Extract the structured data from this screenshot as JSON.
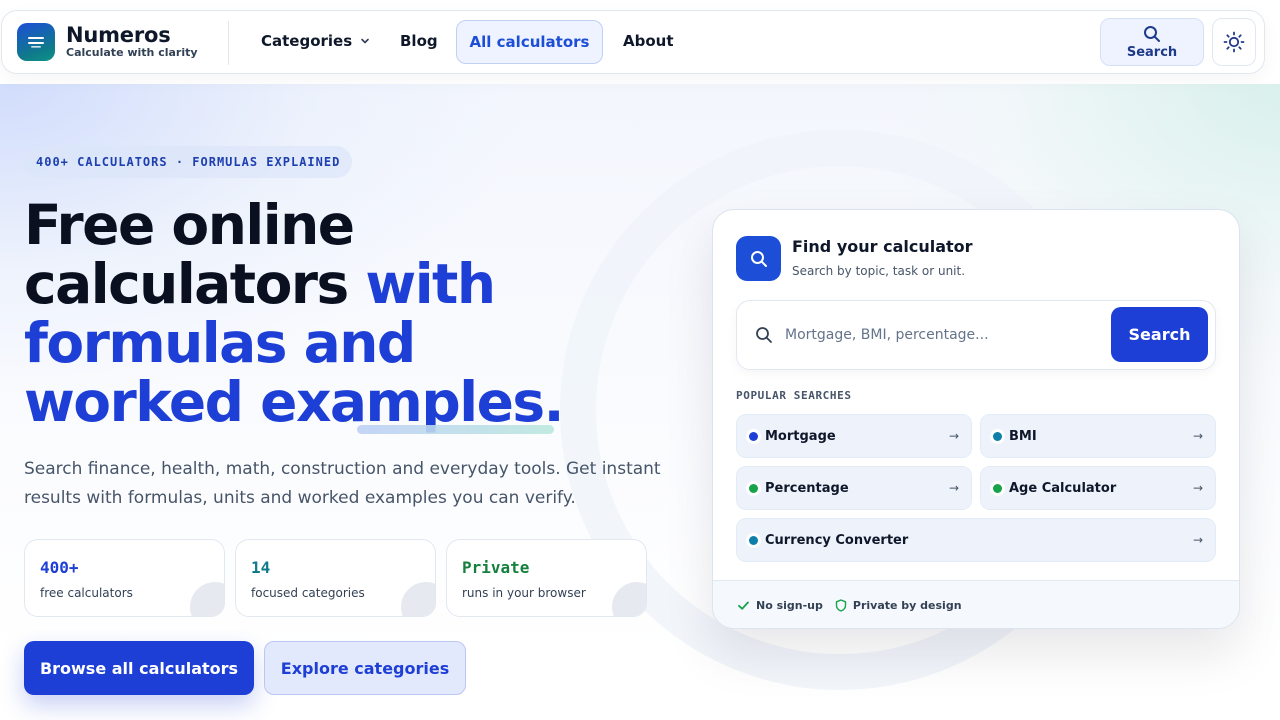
{
  "brand": {
    "name": "Numeros",
    "tagline": "Calculate with clarity",
    "logo_icon": "menu-icon",
    "colors": {
      "primary": "#1d3fd6",
      "teal": "#0d9488"
    }
  },
  "nav": {
    "categories": "Categories",
    "blog": "Blog",
    "all_calculators": "All calculators",
    "about": "About",
    "search": "Search",
    "theme_icon": "sun-icon"
  },
  "hero": {
    "eyebrow": "400+ CALCULATORS · FORMULAS EXPLAINED",
    "headline_line1": "Free online",
    "headline_line2_plain": "calculators ",
    "headline_line2_accent": "with",
    "headline_line3": "formulas and",
    "headline_line4": "worked examples.",
    "lede": "Search finance, health, math, construction and everyday tools. Get instant results with formulas, units and worked examples you can verify.",
    "stats": [
      {
        "value": "400+",
        "label": "free calculators",
        "color": "#1d3fd6"
      },
      {
        "value": "14",
        "label": "focused categories",
        "color": "#0f7a8a"
      },
      {
        "value": "Private",
        "label": "runs in your browser",
        "color": "#15803d"
      }
    ],
    "primary_cta": "Browse all calculators",
    "secondary_cta": "Explore categories"
  },
  "finder": {
    "title": "Find your calculator",
    "subtitle": "Search by topic, task or unit.",
    "placeholder": "Mortgage, BMI, percentage...",
    "value": "",
    "submit": "Search",
    "popular_label": "POPULAR SEARCHES",
    "popular": [
      {
        "label": "Mortgage",
        "dot": "#1d3fd6"
      },
      {
        "label": "BMI",
        "dot": "#0e7fa8"
      },
      {
        "label": "Percentage",
        "dot": "#16a34a"
      },
      {
        "label": "Age Calculator",
        "dot": "#16a34a"
      },
      {
        "label": "Currency Converter",
        "dot": "#0e7fa8"
      }
    ],
    "arrow": "→",
    "footer": [
      {
        "label": "No sign-up",
        "icon": "check-icon"
      },
      {
        "label": "Private by design",
        "icon": "shield-icon"
      }
    ]
  }
}
